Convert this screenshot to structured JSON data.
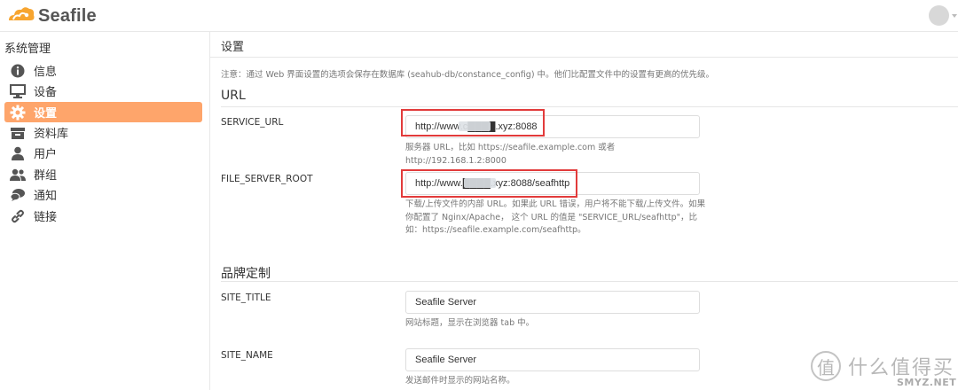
{
  "app": {
    "brand_name": "Seafile",
    "brand_color": "#f7a530"
  },
  "sidebar": {
    "heading": "系统管理",
    "active_color": "#fea56b",
    "items": [
      {
        "label": "信息",
        "icon": "info-icon"
      },
      {
        "label": "设备",
        "icon": "monitor-icon"
      },
      {
        "label": "设置",
        "icon": "gear-icon",
        "active": true
      },
      {
        "label": "资料库",
        "icon": "library-icon"
      },
      {
        "label": "用户",
        "icon": "user-icon"
      },
      {
        "label": "群组",
        "icon": "group-icon"
      },
      {
        "label": "通知",
        "icon": "chat-icon"
      },
      {
        "label": "链接",
        "icon": "link-icon"
      }
    ]
  },
  "main": {
    "title": "设置",
    "notice": "注意：通过 Web 界面设置的选项会保存在数据库 (seahub-db/constance_config) 中。他们比配置文件中的设置有更高的优先级。",
    "sections": [
      {
        "title": "URL",
        "fields": [
          {
            "label": "SERVICE_URL",
            "value": "http://www.c████.xyz:8088",
            "help": "服务器 URL，比如 https://seafile.example.com 或者 http://192.168.1.2:8000"
          },
          {
            "label": "FILE_SERVER_ROOT",
            "value": "http://www.████.xyz:8088/seafhttp",
            "help": "下载/上传文件的内部 URL。如果此 URL 错误，用户将不能下载/上传文件。如果你配置了 Nginx/Apache，  这个 URL 的值是 \"SERVICE_URL/seafhttp\"，比如：https://seafile.example.com/seafhttp。"
          }
        ]
      },
      {
        "title": "品牌定制",
        "fields": [
          {
            "label": "SITE_TITLE",
            "value": "Seafile Server",
            "help": "网站标题，显示在浏览器 tab 中。"
          },
          {
            "label": "SITE_NAME",
            "value": "Seafile Server",
            "help": "发送邮件时显示的网站名称。"
          }
        ]
      }
    ]
  },
  "highlight_color": "#e23b3b",
  "watermark": {
    "glyph": "值",
    "text": "什么值得买",
    "site": "SMYZ.NET"
  }
}
